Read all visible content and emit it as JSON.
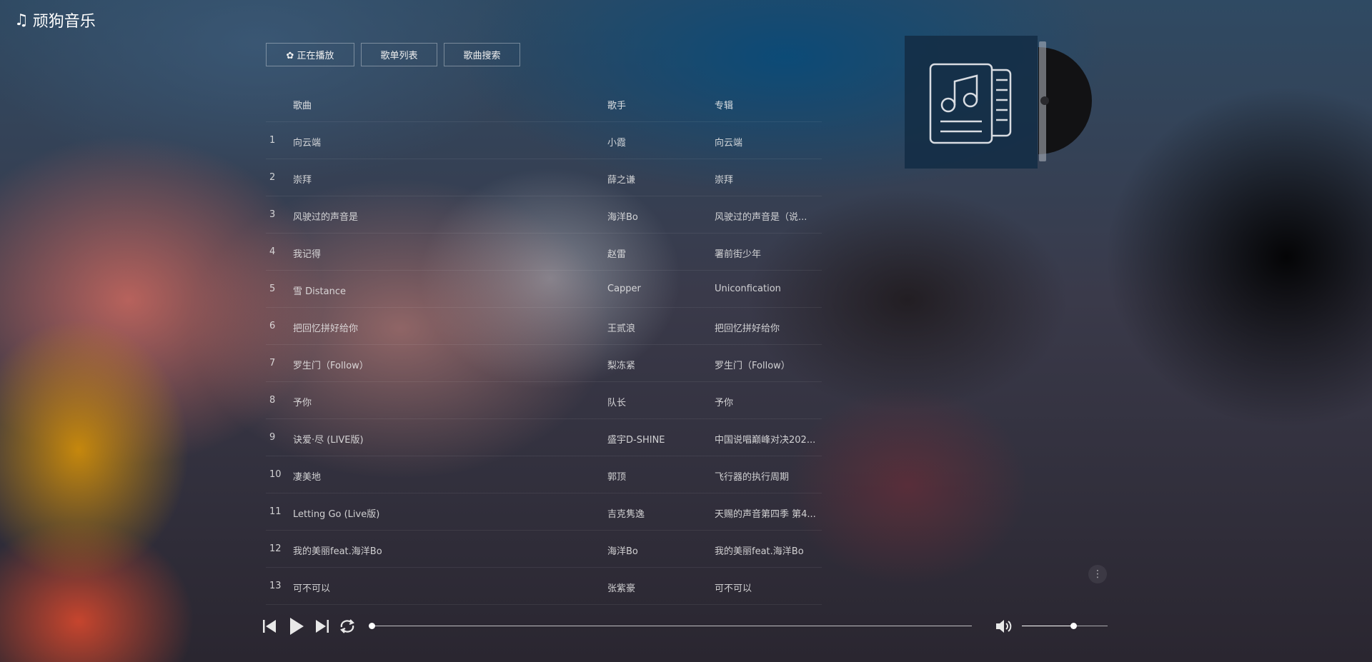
{
  "app": {
    "icon": "music-note-icon",
    "title": "顽狗音乐"
  },
  "tabs": [
    {
      "label": "✿ 正在播放"
    },
    {
      "label": "歌单列表"
    },
    {
      "label": "歌曲搜索"
    }
  ],
  "table": {
    "headers": {
      "title": "歌曲",
      "artist": "歌手",
      "album": "专辑"
    },
    "rows": [
      {
        "idx": "1",
        "title": "向云端",
        "artist": "小霞",
        "album": "向云端"
      },
      {
        "idx": "2",
        "title": "崇拜",
        "artist": "薛之谦",
        "album": "崇拜"
      },
      {
        "idx": "3",
        "title": "风驶过的声音是",
        "artist": "海洋Bo",
        "album": "风驶过的声音是（说..."
      },
      {
        "idx": "4",
        "title": "我记得",
        "artist": "赵雷",
        "album": "署前街少年"
      },
      {
        "idx": "5",
        "title": "雪 Distance",
        "artist": "Capper",
        "album": "Uniconfication"
      },
      {
        "idx": "6",
        "title": "把回忆拼好给你",
        "artist": "王贰浪",
        "album": "把回忆拼好给你"
      },
      {
        "idx": "7",
        "title": "罗生门（Follow）",
        "artist": "梨冻紧",
        "album": "罗生门（Follow）"
      },
      {
        "idx": "8",
        "title": "予你",
        "artist": "队长",
        "album": "予你"
      },
      {
        "idx": "9",
        "title": "诀爱·尽 (LIVE版)",
        "artist": "盛宇D-SHINE",
        "album": "中国说唱巅峰对决202..."
      },
      {
        "idx": "10",
        "title": "凄美地",
        "artist": "郭顶",
        "album": "飞行器的执行周期"
      },
      {
        "idx": "11",
        "title": "Letting Go (Live版)",
        "artist": "吉克隽逸",
        "album": "天赐的声音第四季 第4..."
      },
      {
        "idx": "12",
        "title": "我的美丽feat.海洋Bo",
        "artist": "海洋Bo",
        "album": "我的美丽feat.海洋Bo"
      },
      {
        "idx": "13",
        "title": "可不可以",
        "artist": "张紫豪",
        "album": "可不可以"
      }
    ]
  },
  "cover": {
    "icon": "music-document-icon"
  },
  "more": {
    "icon": "vertical-dots-icon",
    "glyph": "⋮"
  },
  "player": {
    "prev_icon": "previous-icon",
    "play_icon": "play-icon",
    "next_icon": "next-icon",
    "loop_icon": "loop-icon",
    "volume_icon": "volume-icon",
    "progress": 0,
    "volume": 0.6
  }
}
